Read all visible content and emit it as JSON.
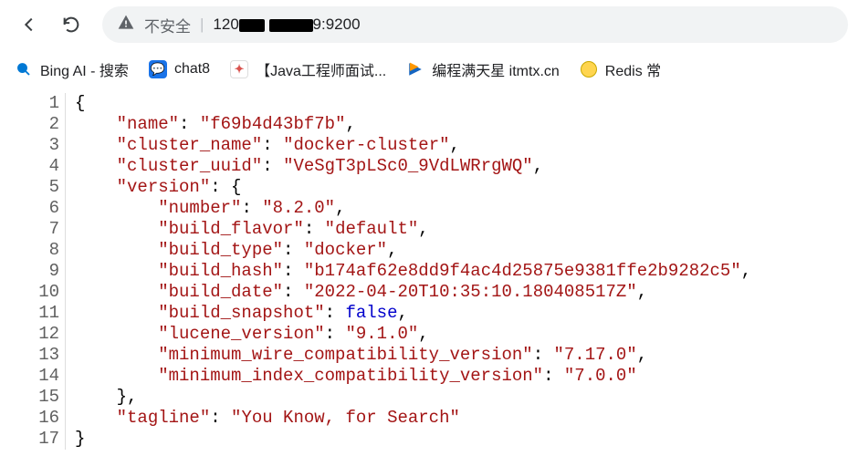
{
  "toolbar": {
    "security_label": "不安全",
    "url_visible_prefix": "120",
    "url_visible_suffix": "9:9200"
  },
  "bookmarks": [
    {
      "label": "Bing AI - 搜索"
    },
    {
      "label": "chat8"
    },
    {
      "label": "【Java工程师面试..."
    },
    {
      "label": "编程满天星 itmtx.cn"
    },
    {
      "label": "Redis 常"
    }
  ],
  "line_numbers": [
    "1",
    "2",
    "3",
    "4",
    "5",
    "6",
    "7",
    "8",
    "9",
    "10",
    "11",
    "12",
    "13",
    "14",
    "15",
    "16",
    "17"
  ],
  "json_body": {
    "name_key": "\"name\"",
    "name_val": "\"f69b4d43bf7b\"",
    "cluster_name_key": "\"cluster_name\"",
    "cluster_name_val": "\"docker-cluster\"",
    "cluster_uuid_key": "\"cluster_uuid\"",
    "cluster_uuid_val": "\"VeSgT3pLSc0_9VdLWRrgWQ\"",
    "version_key": "\"version\"",
    "number_key": "\"number\"",
    "number_val": "\"8.2.0\"",
    "build_flavor_key": "\"build_flavor\"",
    "build_flavor_val": "\"default\"",
    "build_type_key": "\"build_type\"",
    "build_type_val": "\"docker\"",
    "build_hash_key": "\"build_hash\"",
    "build_hash_val": "\"b174af62e8dd9f4ac4d25875e9381ffe2b9282c5\"",
    "build_date_key": "\"build_date\"",
    "build_date_val": "\"2022-04-20T10:35:10.180408517Z\"",
    "build_snapshot_key": "\"build_snapshot\"",
    "build_snapshot_val": "false",
    "lucene_version_key": "\"lucene_version\"",
    "lucene_version_val": "\"9.1.0\"",
    "min_wire_key": "\"minimum_wire_compatibility_version\"",
    "min_wire_val": "\"7.17.0\"",
    "min_index_key": "\"minimum_index_compatibility_version\"",
    "min_index_val": "\"7.0.0\"",
    "tagline_key": "\"tagline\"",
    "tagline_val": "\"You Know, for Search\""
  }
}
